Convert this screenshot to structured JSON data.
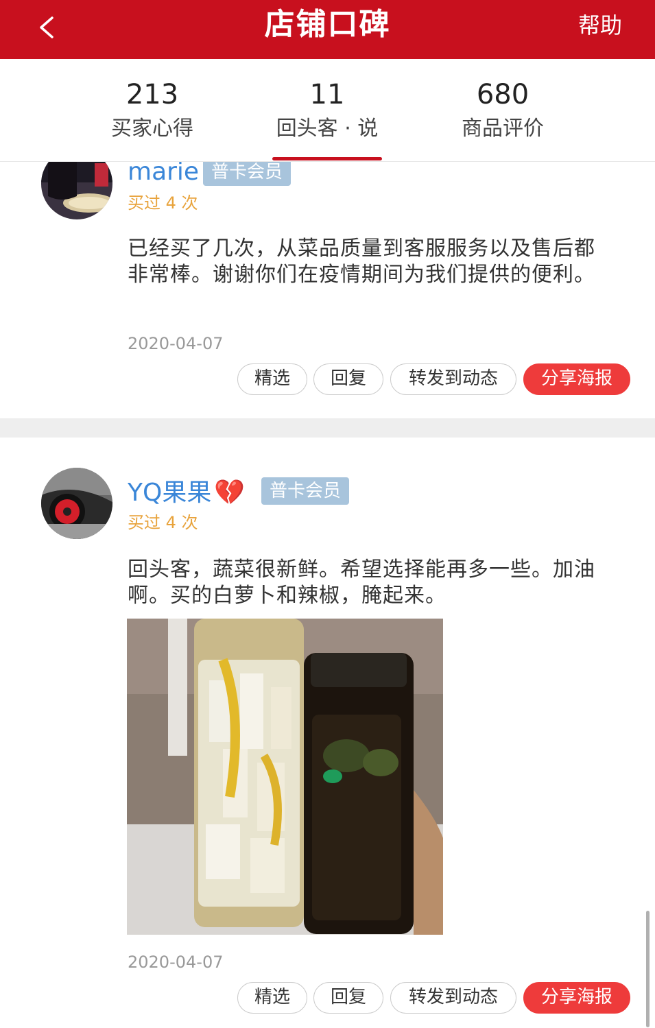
{
  "header": {
    "title": "店铺口碑",
    "help_label": "帮助"
  },
  "stats": [
    {
      "count": "213",
      "label": "买家心得"
    },
    {
      "count": "11",
      "label": "回头客 · 说"
    },
    {
      "count": "680",
      "label": "商品评价"
    }
  ],
  "active_tab_index": 1,
  "colors": {
    "brand_red": "#c8101e",
    "username_blue": "#3a86d8",
    "bought_orange": "#e8a33c",
    "badge_blue": "#a8c4dc",
    "share_red": "#ee3b3b"
  },
  "reviews": [
    {
      "username": "marie",
      "badge": "普卡会员",
      "bought": "买过 4 次",
      "text": "已经买了几次，从菜品质量到客服服务以及售后都非常棒。谢谢你们在疫情期间为我们提供的便利。",
      "date": "2020-04-07",
      "actions": [
        "精选",
        "回复",
        "转发到动态",
        "分享海报"
      ]
    },
    {
      "username": "YQ果果",
      "username_emoji": "💔",
      "badge": "普卡会员",
      "bought": "买过 4 次",
      "text": "回头客，蔬菜很新鲜。希望选择能再多一些。加油啊。买的白萝卜和辣椒，腌起来。",
      "date": "2020-04-07",
      "actions": [
        "精选",
        "回复",
        "转发到动态",
        "分享海报"
      ]
    }
  ]
}
